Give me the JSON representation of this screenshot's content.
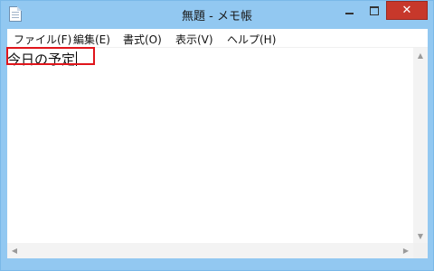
{
  "window": {
    "title": "無題 - メモ帳",
    "icon": "notepad-icon",
    "frame_color": "#92c8f1",
    "close_symbol": "✕",
    "close_color": "#c7382b"
  },
  "menu": {
    "items": [
      {
        "label": "ファイル(F)"
      },
      {
        "label": "編集(E)"
      },
      {
        "label": "書式(O)"
      },
      {
        "label": "表示(V)"
      },
      {
        "label": "ヘルプ(H)"
      }
    ]
  },
  "editor": {
    "text": "今日の予定",
    "highlight_color": "#e0151b"
  }
}
